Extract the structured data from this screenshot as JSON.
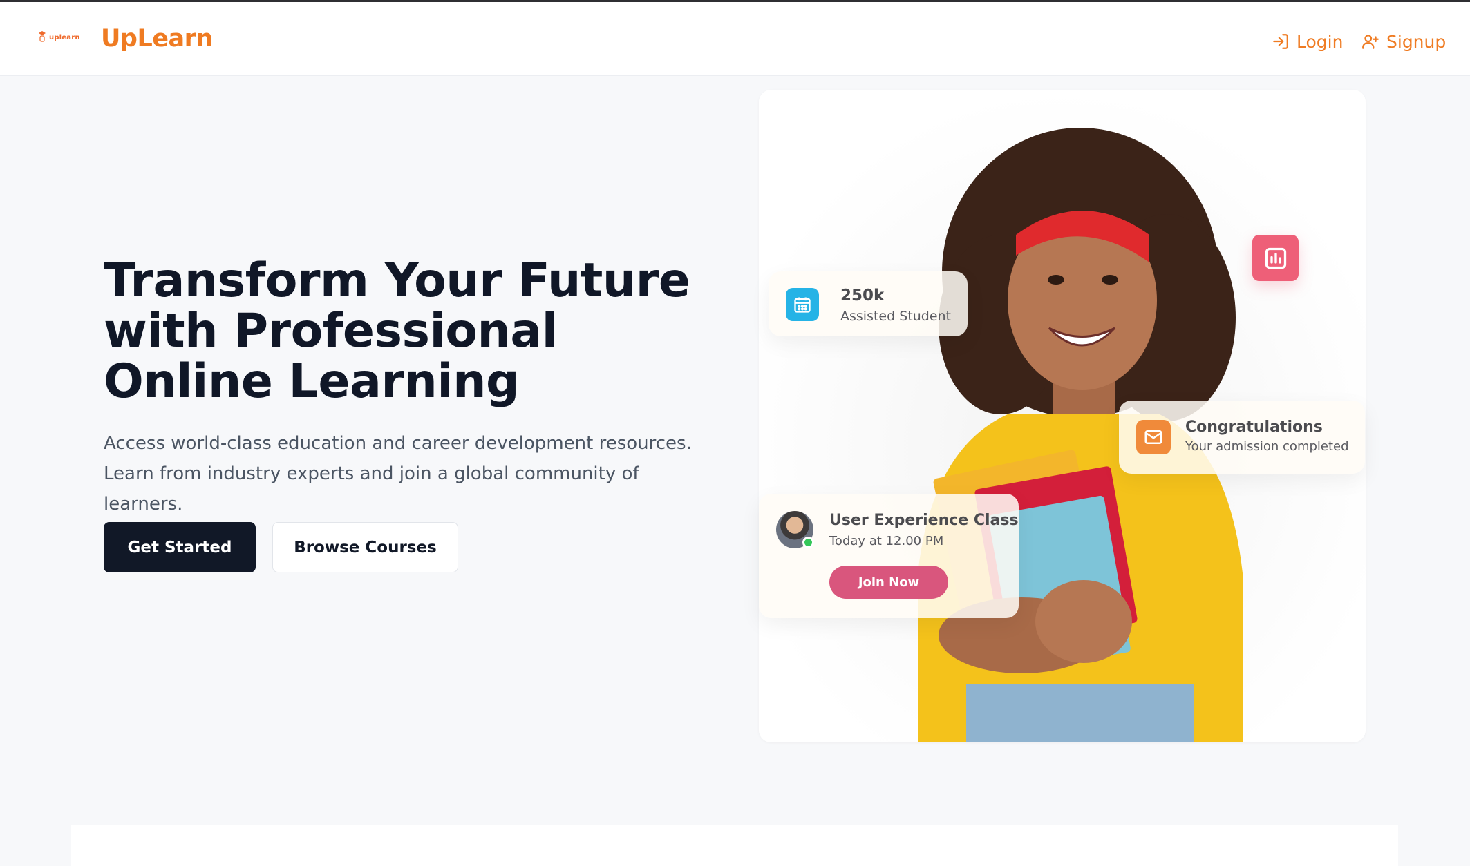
{
  "brand": {
    "logo_small_text": "uplearn",
    "name": "UpLearn",
    "color": "#ef7b22"
  },
  "nav": {
    "login": {
      "label": "Login",
      "icon": "login-icon"
    },
    "signup": {
      "label": "Signup",
      "icon": "user-plus-icon"
    }
  },
  "hero": {
    "title": "Transform Your Future with Professional Online Learning",
    "subtitle": "Access world-class education and career development resources. Learn from industry experts and join a global community of learners.",
    "primary_button": "Get Started",
    "secondary_button": "Browse Courses"
  },
  "cards": {
    "students": {
      "value": "250k",
      "label": "Assisted Student",
      "icon": "calendar-icon"
    },
    "congrats": {
      "title": "Congratulations",
      "subtitle": "Your admission completed",
      "icon": "mail-icon"
    },
    "class": {
      "title": "User Experience Class",
      "time": "Today at 12.00 PM",
      "button": "Join Now"
    },
    "chart_badge": {
      "icon": "bar-chart-icon"
    }
  },
  "colors": {
    "dark": "#111827",
    "accent_orange": "#ef7b22",
    "blue": "#25b3e6",
    "pink": "#d9567d",
    "rose": "#ee5f78"
  }
}
